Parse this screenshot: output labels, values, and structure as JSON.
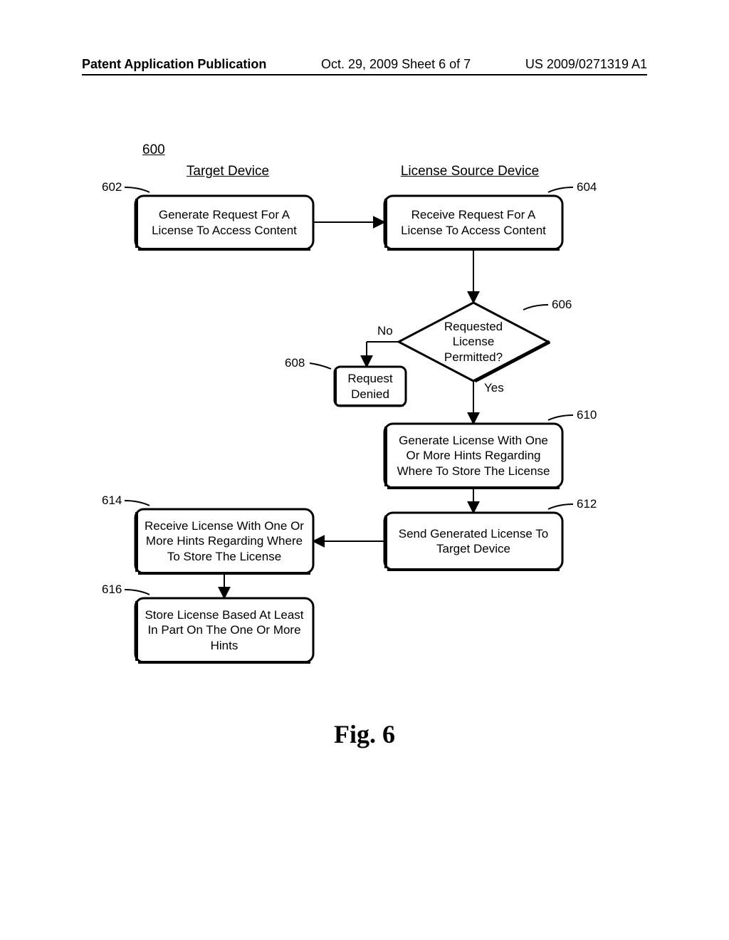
{
  "header": {
    "left": "Patent Application Publication",
    "mid": "Oct. 29, 2009  Sheet 6 of 7",
    "right": "US 2009/0271319 A1"
  },
  "figure_caption": "Fig. 6",
  "diagram": {
    "reference_numeral": "600",
    "lanes": {
      "target": "Target Device",
      "source": "License Source Device"
    },
    "nodes": {
      "n602": {
        "ref": "602",
        "text": "Generate Request For A License To Access Content"
      },
      "n604": {
        "ref": "604",
        "text": "Receive Request For A License To Access Content"
      },
      "n606": {
        "ref": "606",
        "text": "Requested License Permitted?"
      },
      "n608": {
        "ref": "608",
        "text": "Request Denied"
      },
      "n610": {
        "ref": "610",
        "text": "Generate License With One Or More Hints Regarding Where To Store The License"
      },
      "n612": {
        "ref": "612",
        "text": "Send Generated License To Target Device"
      },
      "n614": {
        "ref": "614",
        "text": "Receive License With One Or More Hints Regarding Where To Store The License"
      },
      "n616": {
        "ref": "616",
        "text": "Store License Based At Least In Part On The One Or More Hints"
      }
    },
    "edge_labels": {
      "no": "No",
      "yes": "Yes"
    }
  }
}
